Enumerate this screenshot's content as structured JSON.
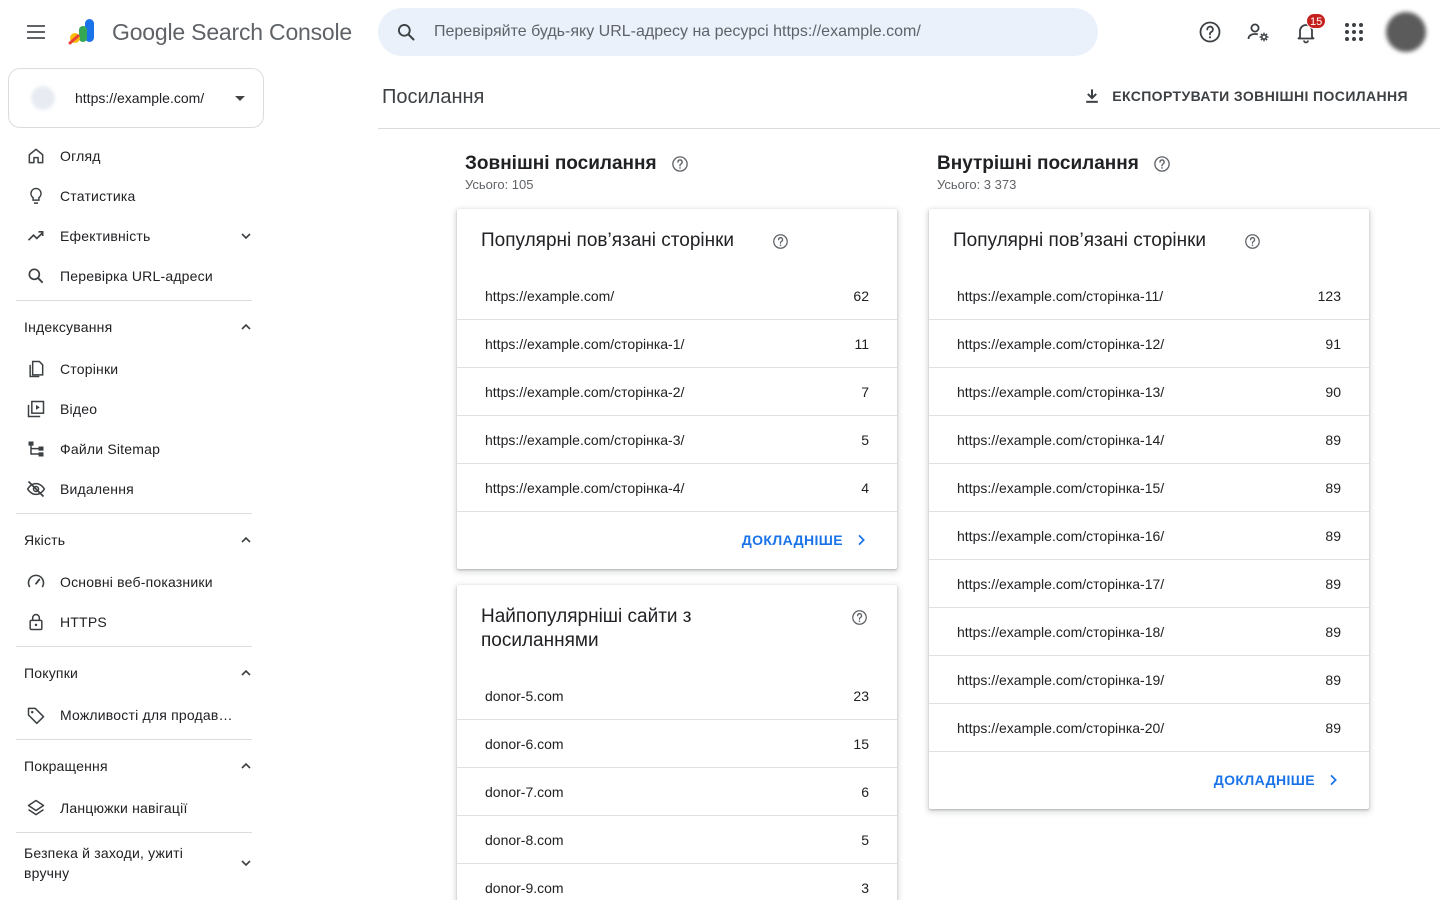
{
  "app": {
    "logo_google": "Google",
    "logo_product": "Search Console"
  },
  "search": {
    "placeholder": "Перевіряйте будь-яку URL-адресу на ресурсі https://example.com/"
  },
  "notifications": {
    "count": "15"
  },
  "property": {
    "url": "https://example.com/"
  },
  "nav": {
    "overview": "Огляд",
    "insights": "Статистика",
    "performance": "Ефективність",
    "url_inspection": "Перевірка URL-адреси",
    "indexing": "Індексування",
    "pages": "Сторінки",
    "video": "Відео",
    "sitemaps": "Файли Sitemap",
    "removals": "Видалення",
    "quality": "Якість",
    "core_web_vitals": "Основні веб-показники",
    "https": "HTTPS",
    "shopping": "Покупки",
    "merchant": "Можливості для продавців",
    "enhancements": "Покращення",
    "breadcrumbs": "Ланцюжки навігації",
    "security": "Безпека й заходи, ужиті вручну"
  },
  "header": {
    "title": "Посилання",
    "export": "ЕКСПОРТУВАТИ ЗОВНІШНІ ПОСИЛАННЯ"
  },
  "external": {
    "title": "Зовнішні посилання",
    "total": "Усього: 105",
    "top_pages": {
      "title": "Популярні пов’язані сторінки",
      "rows": [
        {
          "url": "https://example.com/",
          "count": "62"
        },
        {
          "url": "https://example.com/сторінка-1/",
          "count": "11"
        },
        {
          "url": "https://example.com/сторінка-2/",
          "count": "7"
        },
        {
          "url": "https://example.com/сторінка-3/",
          "count": "5"
        },
        {
          "url": "https://example.com/сторінка-4/",
          "count": "4"
        }
      ],
      "more": "ДОКЛАДНІШЕ"
    },
    "top_sites": {
      "title_line1": "Найпопулярніші сайти з",
      "title_line2": "посиланнями",
      "rows": [
        {
          "url": "donor-5.com",
          "count": "23"
        },
        {
          "url": "donor-6.com",
          "count": "15"
        },
        {
          "url": "donor-7.com",
          "count": "6"
        },
        {
          "url": "donor-8.com",
          "count": "5"
        },
        {
          "url": "donor-9.com",
          "count": "3"
        }
      ]
    }
  },
  "internal": {
    "title": "Внутрішні посилання",
    "total": "Усього: 3 373",
    "top_pages": {
      "title": "Популярні пов’язані сторінки",
      "rows": [
        {
          "url": "https://example.com/сторінка-11/",
          "count": "123"
        },
        {
          "url": "https://example.com/сторінка-12/",
          "count": "91"
        },
        {
          "url": "https://example.com/сторінка-13/",
          "count": "90"
        },
        {
          "url": "https://example.com/сторінка-14/",
          "count": "89"
        },
        {
          "url": "https://example.com/сторінка-15/",
          "count": "89"
        },
        {
          "url": "https://example.com/сторінка-16/",
          "count": "89"
        },
        {
          "url": "https://example.com/сторінка-17/",
          "count": "89"
        },
        {
          "url": "https://example.com/сторінка-18/",
          "count": "89"
        },
        {
          "url": "https://example.com/сторінка-19/",
          "count": "89"
        },
        {
          "url": "https://example.com/сторінка-20/",
          "count": "89"
        }
      ],
      "more": "ДОКЛАДНІШЕ"
    }
  },
  "colors": {
    "accent": "#1a73e8",
    "search_bg": "#eaf1fb",
    "badge": "#c5221f"
  }
}
